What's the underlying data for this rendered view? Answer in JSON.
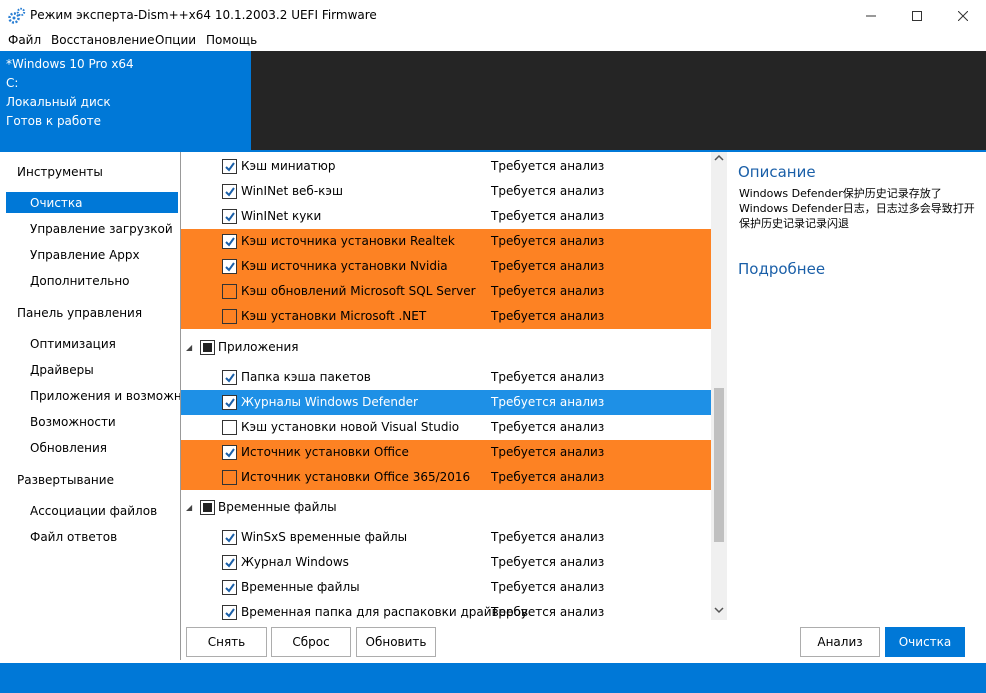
{
  "window": {
    "title": "Режим эксперта-Dism++x64 10.1.2003.2 UEFI Firmware"
  },
  "menu": [
    "Файл",
    "Восстановление",
    "Опции",
    "Помощь"
  ],
  "info": [
    "*Windows 10 Pro x64",
    "C:",
    "Локальный диск",
    "Готов к работе"
  ],
  "sidebar": {
    "sections": [
      {
        "title": "Инструменты",
        "items": [
          "Очистка",
          "Управление загрузкой",
          "Управление Appx",
          "Дополнительно"
        ]
      },
      {
        "title": "Панель управления",
        "items": [
          "Оптимизация",
          "Драйверы",
          "Приложения и возможности",
          "Возможности",
          "Обновления"
        ]
      },
      {
        "title": "Развертывание",
        "items": [
          "Ассоциации файлов",
          "Файл ответов"
        ]
      }
    ],
    "selected": "Очистка"
  },
  "list": {
    "rows1": [
      {
        "label": "Кэш миниатюр",
        "status": "Требуется анализ",
        "checked": true,
        "style": "normal"
      },
      {
        "label": "WinINet веб-кэш",
        "status": "Требуется анализ",
        "checked": true,
        "style": "normal"
      },
      {
        "label": "WinINet куки",
        "status": "Требуется анализ",
        "checked": true,
        "style": "normal"
      },
      {
        "label": "Кэш источника установки Realtek",
        "status": "Требуется анализ",
        "checked": true,
        "style": "orange"
      },
      {
        "label": "Кэш источника установки Nvidia",
        "status": "Требуется анализ",
        "checked": true,
        "style": "orange"
      },
      {
        "label": "Кэш обновлений Microsoft SQL Server",
        "status": "Требуется анализ",
        "checked": false,
        "style": "orange"
      },
      {
        "label": "Кэш установки Microsoft .NET",
        "status": "Требуется анализ",
        "checked": false,
        "style": "orange"
      }
    ],
    "group2": "Приложения",
    "rows2": [
      {
        "label": "Папка кэша пакетов",
        "status": "Требуется анализ",
        "checked": true,
        "style": "normal"
      },
      {
        "label": "Журналы Windows Defender",
        "status": "Требуется анализ",
        "checked": true,
        "style": "sel"
      },
      {
        "label": "Кэш установки новой Visual Studio",
        "status": "Требуется анализ",
        "checked": false,
        "style": "normal"
      },
      {
        "label": "Источник установки Office",
        "status": "Требуется анализ",
        "checked": true,
        "style": "orange"
      },
      {
        "label": "Источник установки Office 365/2016",
        "status": "Требуется анализ",
        "checked": false,
        "style": "orange"
      }
    ],
    "group3": "Временные файлы",
    "rows3": [
      {
        "label": "WinSxS временные файлы",
        "status": "Требуется анализ",
        "checked": true,
        "style": "normal"
      },
      {
        "label": "Журнал Windows",
        "status": "Требуется анализ",
        "checked": true,
        "style": "normal"
      },
      {
        "label": "Временные файлы",
        "status": "Требуется анализ",
        "checked": true,
        "style": "normal"
      },
      {
        "label": "Временная папка для распаковки драйверов",
        "status": "Требуется анализ",
        "checked": true,
        "style": "normal"
      }
    ]
  },
  "description": {
    "title": "Описание",
    "text": "Windows Defender保护历史记录存放了Windows Defender日志，日志过多会导致打开保护历史记录记录闪退",
    "more": "Подробнее"
  },
  "buttons": {
    "uncheck": "Снять",
    "reset": "Сброс",
    "refresh": "Обновить",
    "analyze": "Анализ",
    "clean": "Очистка"
  },
  "colors": {
    "accent": "#0078d7",
    "orange": "#fd8223"
  }
}
